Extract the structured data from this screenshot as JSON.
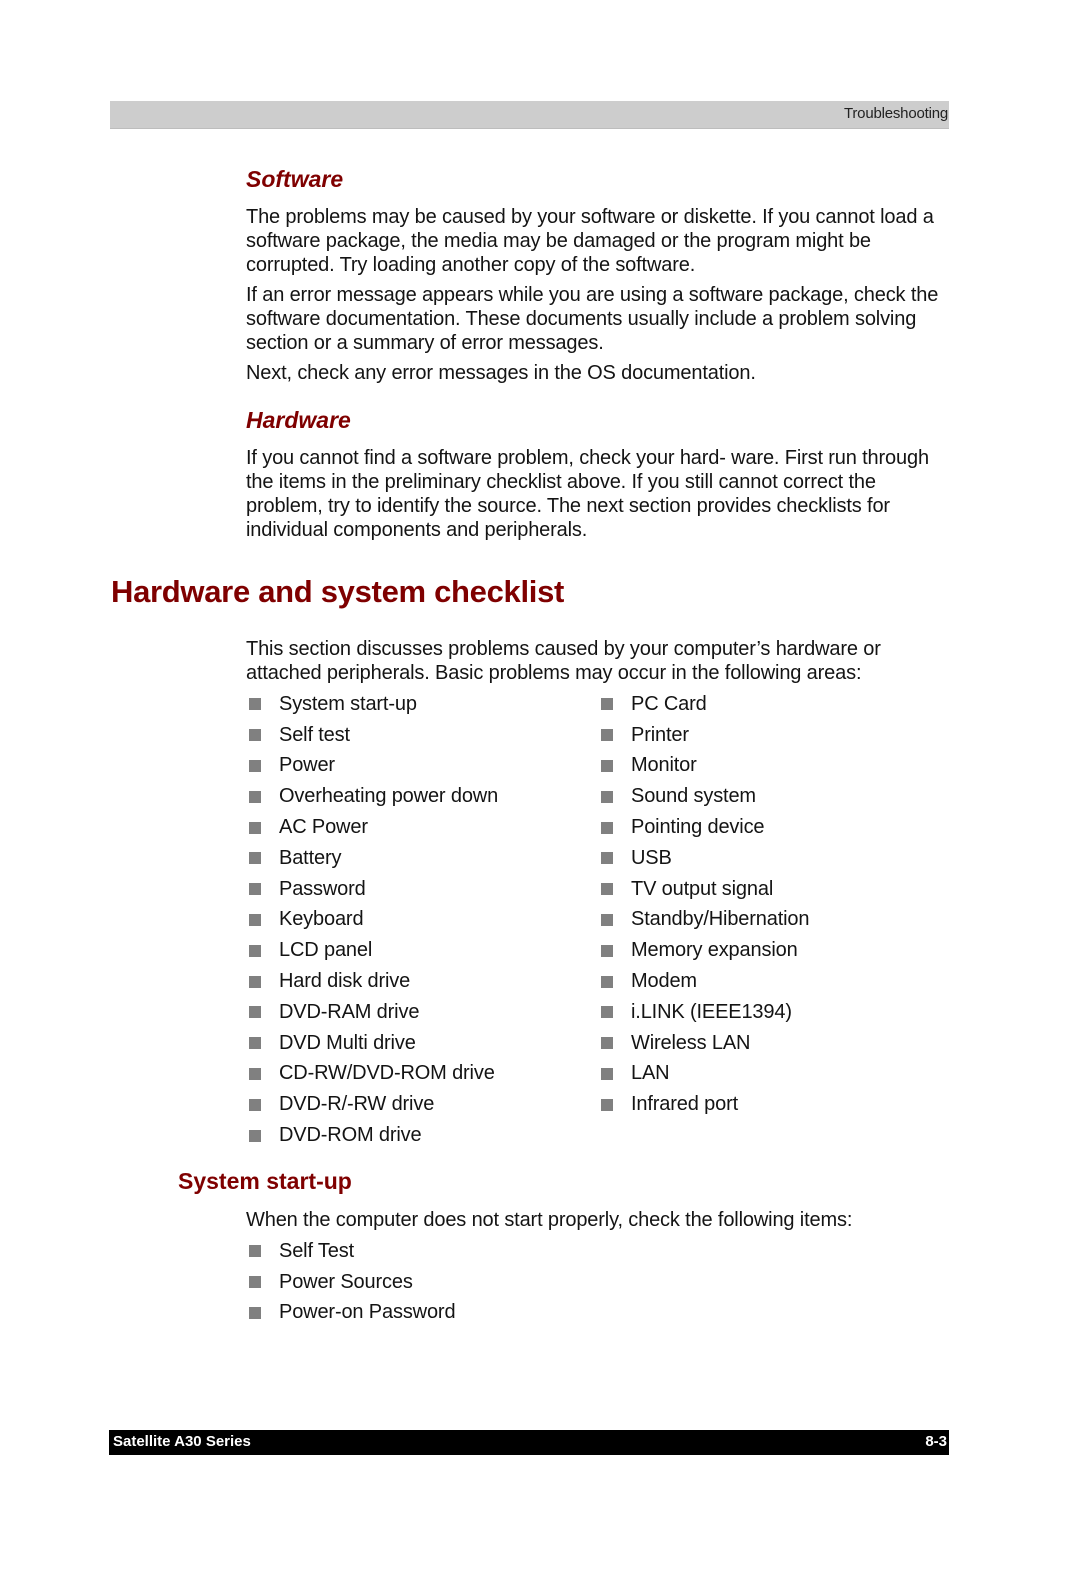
{
  "header": {
    "running_head": "Troubleshooting"
  },
  "software": {
    "heading": "Software",
    "paragraphs": [
      "The problems may be caused by your software or diskette. If you cannot load a software package, the media may be damaged or the program might be corrupted. Try loading another copy of the software.",
      "If an error message appears while you are using a software package, check the software documentation. These documents usually include a problem solving section or a summary of error messages.",
      "Next, check any error messages in the OS documentation."
    ]
  },
  "hardware": {
    "heading": "Hardware",
    "paragraph": "If you cannot find a software problem, check your hard- ware. First run through the items in the preliminary checklist above. If you still cannot correct the problem, try to identify the source. The next section provides checklists for individual components and peripherals."
  },
  "checklist": {
    "heading": "Hardware and system checklist",
    "intro": "This section discusses problems caused by your computer’s hardware or attached peripherals. Basic problems may occur in the following areas:",
    "left_column": [
      "System start-up",
      "Self test",
      "Power",
      "Overheating power down",
      "AC Power",
      "Battery",
      "Password",
      "Keyboard",
      "LCD panel",
      "Hard disk drive",
      "DVD-RAM drive",
      "DVD Multi drive",
      "CD-RW/DVD-ROM drive",
      "DVD-R/-RW drive",
      "DVD-ROM drive"
    ],
    "right_column": [
      "PC Card",
      "Printer",
      "Monitor",
      "Sound system",
      "Pointing device",
      "USB",
      "TV output signal",
      "Standby/Hibernation",
      "Memory expansion",
      "Modem",
      "i.LINK (IEEE1394)",
      "Wireless LAN",
      "LAN",
      "Infrared port"
    ]
  },
  "system_startup": {
    "heading": "System start-up",
    "intro": "When the computer does not start properly, check the following items:",
    "items": [
      "Self Test",
      "Power Sources",
      "Power-on Password"
    ]
  },
  "footer": {
    "product": "Satellite A30 Series",
    "page_number": "8-3"
  },
  "colors": {
    "heading_red": "#7f0000",
    "bullet_gray": "#808080",
    "header_bar_gray": "#cdcdcd",
    "footer_bar_black": "#000000"
  }
}
